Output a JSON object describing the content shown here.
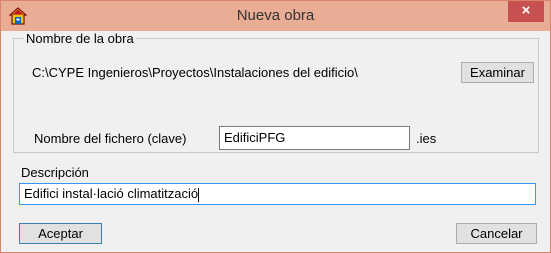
{
  "window": {
    "title": "Nueva obra",
    "close_glyph": "×",
    "app_icon": "house-icon"
  },
  "group": {
    "legend": "Nombre de la obra",
    "path": "C:\\CYPE Ingenieros\\Proyectos\\Instalaciones del edificio\\",
    "browse_label": "Examinar",
    "file_label": "Nombre del fichero (clave)",
    "file_value": "EdificiPFG",
    "extension": ".ies"
  },
  "description": {
    "label": "Descripción",
    "value": "Edifici instal·lació climatització"
  },
  "buttons": {
    "accept": "Aceptar",
    "cancel": "Cancelar"
  },
  "colors": {
    "titlebar": "#e9ac95",
    "close": "#c75050",
    "focus_border": "#3399ff"
  }
}
